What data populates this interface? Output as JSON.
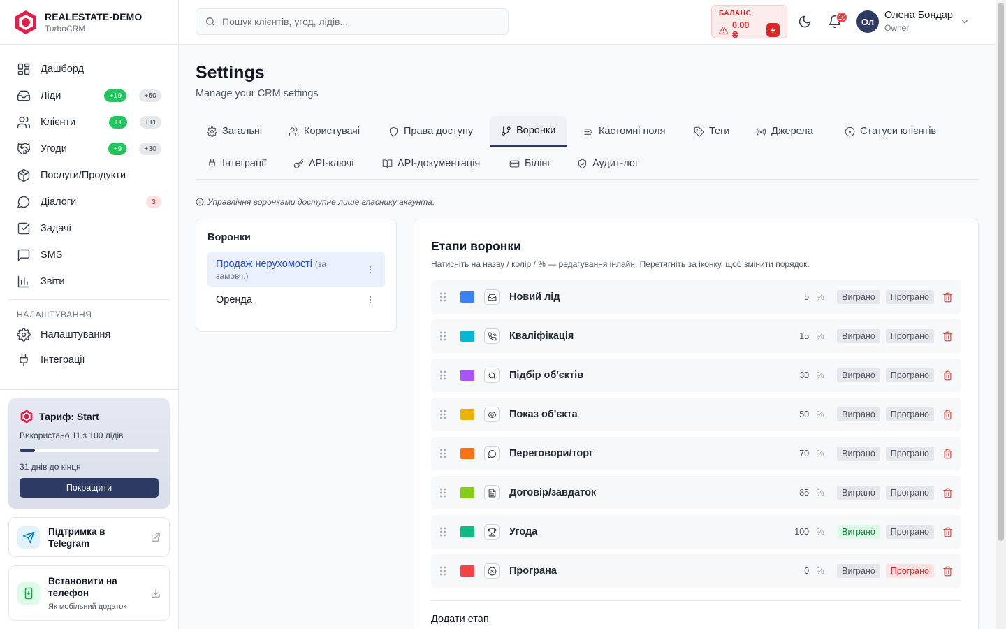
{
  "brand": {
    "name": "REALESTATE-DEMO",
    "sub": "TurboCRM"
  },
  "nav": [
    {
      "label": "Дашборд",
      "icon": "dashboard-icon",
      "badges": []
    },
    {
      "label": "Ліди",
      "icon": "inbox-icon",
      "badges": [
        {
          "text": "+19",
          "style": "green"
        },
        {
          "text": "+50",
          "style": "gray"
        }
      ]
    },
    {
      "label": "Клієнти",
      "icon": "users-icon",
      "badges": [
        {
          "text": "+1",
          "style": "green"
        },
        {
          "text": "+11",
          "style": "gray"
        }
      ]
    },
    {
      "label": "Угоди",
      "icon": "handshake-icon",
      "badges": [
        {
          "text": "+9",
          "style": "green"
        },
        {
          "text": "+30",
          "style": "gray"
        }
      ]
    },
    {
      "label": "Послуги/Продукти",
      "icon": "package-icon",
      "badges": []
    },
    {
      "label": "Діалоги",
      "icon": "chat-icon",
      "badges": [
        {
          "text": "3",
          "style": "red"
        }
      ]
    },
    {
      "label": "Задачі",
      "icon": "checkbox-icon",
      "badges": []
    },
    {
      "label": "SMS",
      "icon": "message-square-icon",
      "badges": []
    },
    {
      "label": "Звіти",
      "icon": "bar-chart-icon",
      "badges": []
    }
  ],
  "nav_section": "НАЛАШТУВАННЯ",
  "nav_settings": [
    {
      "label": "Налаштування",
      "icon": "gear-icon"
    },
    {
      "label": "Інтеграції",
      "icon": "plug-icon"
    }
  ],
  "plan": {
    "title": "Тариф: Start",
    "used": "Використано 11 з 100 лідів",
    "used_fraction": 0.11,
    "days": "31 днів до кінця",
    "button": "Покращити"
  },
  "support": {
    "title": "Підтримка в Telegram"
  },
  "install": {
    "title": "Встановити на телефон",
    "sub": "Як мобільний додаток"
  },
  "topbar": {
    "search_placeholder": "Пошук клієнтів, угод, лідів...",
    "balance_label": "БАЛАНС",
    "balance_value": "0.00 ₴",
    "balance_add": "+",
    "notifications": "10",
    "avatar_initials": "Ол",
    "user_name": "Олена Бондар",
    "user_role": "Owner"
  },
  "page": {
    "title": "Settings",
    "subtitle": "Manage your CRM settings"
  },
  "tabs": [
    {
      "label": "Загальні",
      "icon": "gear-icon",
      "active": false
    },
    {
      "label": "Користувачі",
      "icon": "users-icon",
      "active": false
    },
    {
      "label": "Права доступу",
      "icon": "shield-icon",
      "active": false
    },
    {
      "label": "Воронки",
      "icon": "git-branch-icon",
      "active": true
    },
    {
      "label": "Кастомні поля",
      "icon": "list-icon",
      "active": false
    },
    {
      "label": "Теги",
      "icon": "tag-icon",
      "active": false
    },
    {
      "label": "Джерела",
      "icon": "radio-icon",
      "active": false
    },
    {
      "label": "Статуси клієнтів",
      "icon": "circle-dot-icon",
      "active": false
    },
    {
      "label": "Інтеграції",
      "icon": "plug-icon",
      "active": false
    },
    {
      "label": "API-ключі",
      "icon": "key-icon",
      "active": false
    },
    {
      "label": "API-документація",
      "icon": "book-icon",
      "active": false
    },
    {
      "label": "Білінг",
      "icon": "credit-card-icon",
      "active": false
    },
    {
      "label": "Аудит-лог",
      "icon": "shield-check-icon",
      "active": false
    }
  ],
  "info_note": "Управління воронками доступне лише власнику акаунта.",
  "funnels": {
    "title": "Воронки",
    "items": [
      {
        "name": "Продаж нерухомості",
        "tag": "(за замовч.)",
        "selected": true
      },
      {
        "name": "Оренда",
        "tag": "",
        "selected": false
      }
    ]
  },
  "stages": {
    "title": "Етапи воронки",
    "hint": "Натисніть на назву / колір / % — редагування інлайн. Перетягніть за іконку, щоб змінити порядок.",
    "won_label": "Виграно",
    "lost_label": "Програно",
    "pct_sign": "%",
    "add_title": "Додати етап",
    "items": [
      {
        "name": "Новий лід",
        "pct": "5",
        "color": "#3b82f6",
        "icon": "inbox-icon",
        "won": false,
        "lost": false
      },
      {
        "name": "Кваліфікація",
        "pct": "15",
        "color": "#06b6d4",
        "icon": "phone-call-icon",
        "won": false,
        "lost": false
      },
      {
        "name": "Підбір об'єктів",
        "pct": "30",
        "color": "#a855f7",
        "icon": "search-icon",
        "won": false,
        "lost": false
      },
      {
        "name": "Показ об'єкта",
        "pct": "50",
        "color": "#eab308",
        "icon": "eye-icon",
        "won": false,
        "lost": false
      },
      {
        "name": "Переговори/торг",
        "pct": "70",
        "color": "#f97316",
        "icon": "chat-icon",
        "won": false,
        "lost": false
      },
      {
        "name": "Договір/завдаток",
        "pct": "85",
        "color": "#84cc16",
        "icon": "document-icon",
        "won": false,
        "lost": false
      },
      {
        "name": "Угода",
        "pct": "100",
        "color": "#10b981",
        "icon": "trophy-icon",
        "won": true,
        "lost": false
      },
      {
        "name": "Програна",
        "pct": "0",
        "color": "#ef4444",
        "icon": "x-circle-icon",
        "won": false,
        "lost": true
      }
    ]
  }
}
